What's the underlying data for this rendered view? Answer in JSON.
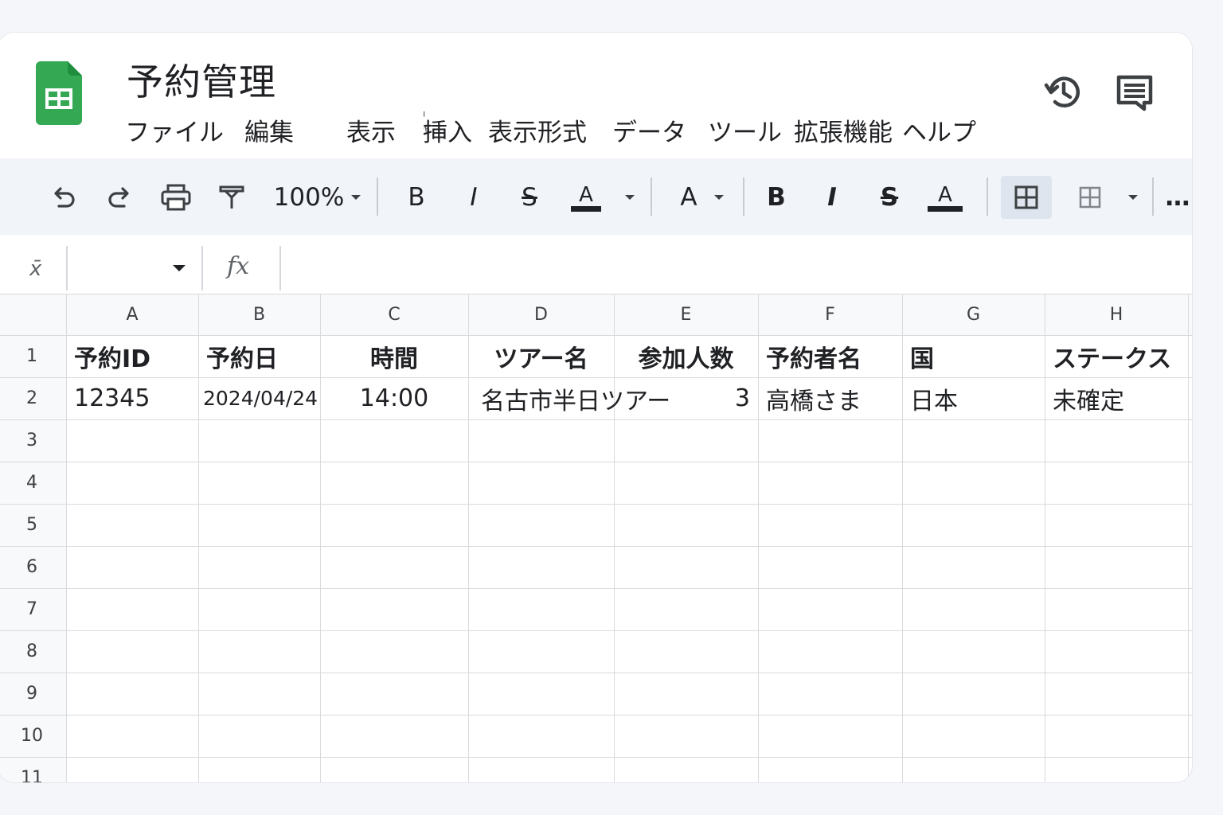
{
  "app": {
    "title": "予約管理",
    "menu": [
      "ファイル",
      "編集",
      "表示",
      "挿入",
      "表示形式",
      "データ",
      "ツール",
      "拡張機能",
      "ヘルプ"
    ],
    "menu_mark": "ᑊ ᕻ",
    "header_icons": [
      "history-icon",
      "comment-icon"
    ]
  },
  "toolbar": {
    "zoom": "100%",
    "bold_label": "B",
    "italic_label": "I",
    "strike_label": "S",
    "text_color_label": "A",
    "font_size_label": "A",
    "bold2_label": "B",
    "italic2_label": "I",
    "strike2_label": "S",
    "text_color2_label": "A",
    "more_label": "…"
  },
  "formula_bar": {
    "name_box_value": "",
    "fx_label": "fx",
    "corner_label": "x̄",
    "formula_value": ""
  },
  "sheet": {
    "columns": [
      "A",
      "B",
      "C",
      "D",
      "E",
      "F",
      "G",
      "H"
    ],
    "rows": [
      "1",
      "2",
      "3",
      "4",
      "5",
      "6",
      "7",
      "8",
      "9",
      "10",
      "11"
    ],
    "header_row": [
      "予約ID",
      "予約日",
      "時間",
      "ツアー名",
      "参加人数",
      "予約者名",
      "国",
      "ステークス"
    ],
    "data_rows": [
      [
        "12345",
        "2024/04/24",
        "14:00",
        "名古市半日ツアー",
        "3",
        "高橋さま",
        "日本",
        "未確定"
      ]
    ]
  },
  "colors": {
    "accent_green": "#34a853",
    "toolbar_bg": "#f1f4f9",
    "grid_line": "#d8dadd"
  }
}
